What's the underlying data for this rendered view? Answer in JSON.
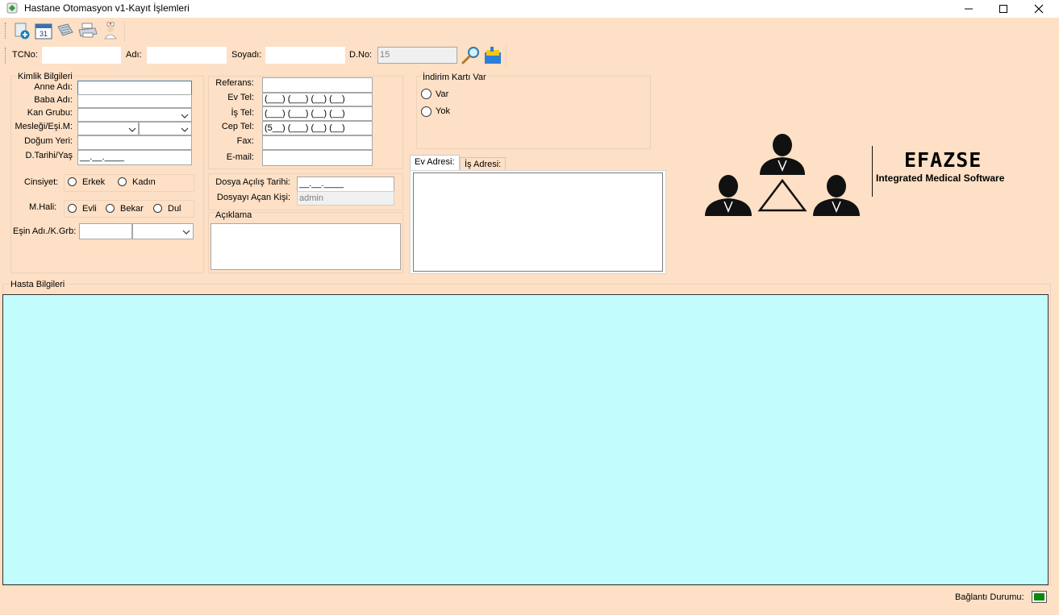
{
  "window": {
    "title": "Hastane Otomasyon v1-Kayıt İşlemleri",
    "minimize": "—",
    "maximize": "☐",
    "close": "✕"
  },
  "toolbar": {
    "calendar_day": "31"
  },
  "search": {
    "tcno_label": "TCNo:",
    "adi_label": "Adı:",
    "soyadi_label": "Soyadı:",
    "dno_label": "D.No:",
    "dno_value": "15"
  },
  "kimlik": {
    "group_label": "Kimlik Bilgileri",
    "anne_label": "Anne Adı:",
    "baba_label": "Baba Adı:",
    "kan_label": "Kan Grubu:",
    "meslek_label": "Mesleği/Eşi.M:",
    "dogum_yeri_label": "Doğum Yeri:",
    "dtarih_label": "D.Tarihi/Yaş",
    "dtarih_mask": "__.__.____",
    "cinsiyet_label": "Cinsiyet:",
    "erkek": "Erkek",
    "kadin": "Kadın",
    "mhali_label": "M.Hali:",
    "evli": "Evli",
    "bekar": "Bekar",
    "dul": "Dul",
    "esin_label": "Eşin Adı./K.Grb:"
  },
  "iletisim": {
    "referans_label": "Referans:",
    "evtel_label": "Ev Tel:",
    "istel_label": "İş Tel:",
    "ceptel_label": "Cep Tel:",
    "fax_label": "Fax:",
    "email_label": "E-mail:",
    "phone_mask": "(___) (___) (__) (__)",
    "cep_mask": "(5__) (___) (__) (__)"
  },
  "dosya": {
    "acilis_label": "Dosya Açılış Tarihi:",
    "acilis_mask": "__.__.____",
    "acan_label": "Dosyayı Açan Kişi:",
    "acan_value": "admin",
    "aciklama_label": "Açıklama"
  },
  "indirim": {
    "group_label": "İndirim Kartı Var",
    "var": "Var",
    "yok": "Yok"
  },
  "adres": {
    "tab_ev": "Ev Adresi:",
    "tab_is": "İş Adresi:"
  },
  "logo": {
    "brand": "EFAZSE",
    "tagline": "Integrated Medical Software"
  },
  "hasta": {
    "group_label": "Hasta Bilgileri"
  },
  "status": {
    "baglanti_label": "Bağlantı Durumu:",
    "indicator_color": "#0a8a0a"
  },
  "colors": {
    "form_bg": "#fde0c5",
    "grid_bg": "#c2fcfd"
  }
}
